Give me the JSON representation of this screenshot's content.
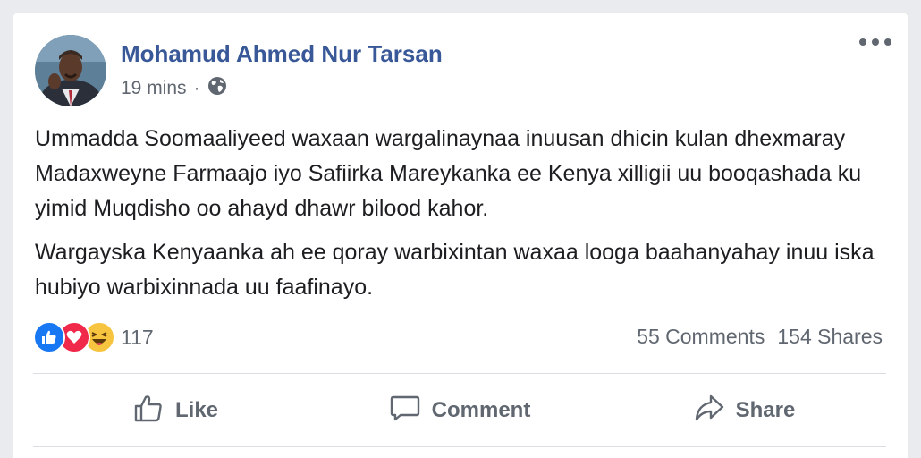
{
  "post": {
    "author": "Mohamud Ahmed Nur Tarsan",
    "time": "19 mins",
    "separator": "·",
    "privacy_icon": "globe-icon",
    "more_icon": "ellipsis-icon",
    "paragraphs": [
      "Ummadda Soomaaliyeed waxaan wargalinaynaa inuusan dhicin kulan dhexmaray Madaxweyne Farmaajo iyo Safiirka Mareykanka ee Kenya xilligii uu booqashada ku yimid Muqdisho oo ahayd dhawr bilood kahor.",
      "Wargayska Kenyaanka ah ee qoray warbixintan waxaa looga baahanyahay inuu iska hubiyo warbixinnada uu faafinayo."
    ]
  },
  "reactions": {
    "icons": [
      "like-reaction-icon",
      "love-reaction-icon",
      "haha-reaction-icon"
    ],
    "count": "117"
  },
  "counts": {
    "comments": "55 Comments",
    "shares": "154 Shares"
  },
  "actions": {
    "like": "Like",
    "comment": "Comment",
    "share": "Share"
  },
  "colors": {
    "author": "#385898",
    "secondary_text": "#606770",
    "body_text": "#1c1e21",
    "like_blue": "#1877f2",
    "love_red": "#f0284a",
    "haha_yellow": "#f7c440"
  }
}
